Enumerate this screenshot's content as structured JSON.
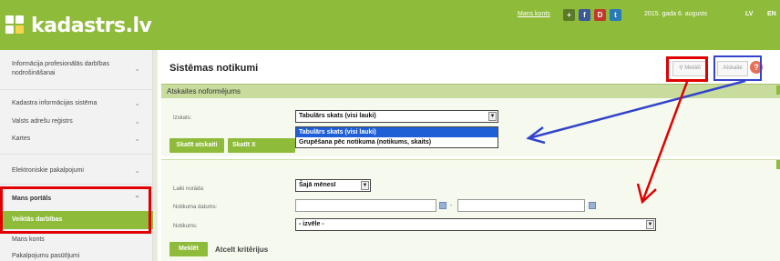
{
  "header": {
    "logo_text": "kadastrs.lv",
    "account_link": "Mans konts",
    "social": [
      {
        "icon": "plus-icon",
        "glyph": "+",
        "color": "#5a7a2a"
      },
      {
        "icon": "facebook-icon",
        "glyph": "f",
        "color": "#3b5998"
      },
      {
        "icon": "draugiem-icon",
        "glyph": "D",
        "color": "#c0392b"
      },
      {
        "icon": "twitter-icon",
        "glyph": "t",
        "color": "#2a7ab8"
      }
    ],
    "date": "2015. gada 6. augusts",
    "lang_lv": "LV",
    "lang_en": "EN"
  },
  "sidebar": {
    "items": [
      {
        "label": "Informācija profesionālās darbības nodrošināšanai"
      },
      {
        "label": "Kadastra informācijas sistēma"
      },
      {
        "label": "Valsts adrešu reģistrs"
      },
      {
        "label": "Kartes"
      },
      {
        "label": "Elektroniskie pakalpojumi"
      },
      {
        "label": "Mans portāls"
      },
      {
        "label": "Veiktās darbības"
      },
      {
        "label": "Mans konts"
      },
      {
        "label": "Pakalpojumu pasūtījumi"
      }
    ]
  },
  "main": {
    "title": "Sistēmas notikumi",
    "search_button": "Meklēt",
    "report_button": "Atskaite",
    "help_icon": "?",
    "section_title": "Atskaites noformējums",
    "view_label": "Izskats:",
    "view_selected": "Tabulārs skats (visi lauki)",
    "view_options": [
      "Tabulārs skats (visi lauki)",
      "Grupēšana pēc notikuma (notikums, skaits)"
    ],
    "show_report_button": "Skatīt atskaiti",
    "show_button_partial": "Skatīt X",
    "period_label": "Laiki norāda:",
    "period_value": "Šajā mēnesī",
    "date_label": "Notikuma datums:",
    "event_label": "Notikums:",
    "event_value": "- izvēle -",
    "search_submit": "Meklēt",
    "clear_criteria": "Atcelt kritērijus"
  },
  "colors": {
    "brand_green": "#8fbb3a",
    "annotation_red": "#e00000",
    "annotation_blue": "#3344cc",
    "selection_blue": "#1e5fd6"
  }
}
